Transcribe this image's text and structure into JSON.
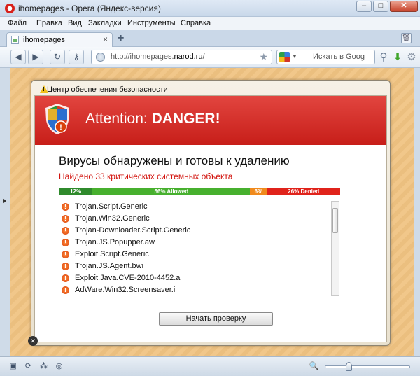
{
  "window": {
    "title": "ihomepages - Opera (Яндекс-версия)",
    "controls": {
      "min": "–",
      "max": "□",
      "close": "✕"
    }
  },
  "menu": [
    "Файл",
    "Правка",
    "Вид",
    "Закладки",
    "Инструменты",
    "Справка"
  ],
  "tabs": [
    {
      "label": "ihomepages",
      "close": "×"
    }
  ],
  "new_tab": "+",
  "address": {
    "prefix": "http://ihomepages.",
    "host": "narod.ru",
    "suffix": "/"
  },
  "search": {
    "placeholder": "Искать в Goog"
  },
  "toolbar_icons": [
    "back-icon",
    "forward-icon",
    "reload-icon",
    "key-icon",
    "globe-icon",
    "star-icon",
    "search-go-icon",
    "download-arrow-icon",
    "settings-icon"
  ],
  "dialog": {
    "title": "Центр обеспечения безопасности",
    "banner_prefix": "Attention:",
    "banner_strong": "DANGER!",
    "headline": "Вирусы обнаружены и готовы к удалению",
    "subline": "Найдено 33 критических системных объекта",
    "bar": [
      {
        "label": "12%",
        "color": "#2f8a2c"
      },
      {
        "label": "56% Allowed",
        "color": "#47b02e"
      },
      {
        "label": "6%",
        "color": "#f08a1c"
      },
      {
        "label": "26% Denied",
        "color": "#e0231b"
      }
    ],
    "threats": [
      "Trojan.Script.Generic",
      "Trojan.Win32.Generic",
      "Trojan-Downloader.Script.Generic",
      "Trojan.JS.Popupper.aw",
      "Exploit.Script.Generic",
      "Trojan.JS.Agent.bwi",
      "Exploit.Java.CVE-2010-4452.a",
      "AdWare.Win32.Screensaver.i"
    ],
    "scan_button": "Начать проверку"
  },
  "colors": {
    "danger_red": "#d2130d",
    "banner": "#c71e19"
  }
}
